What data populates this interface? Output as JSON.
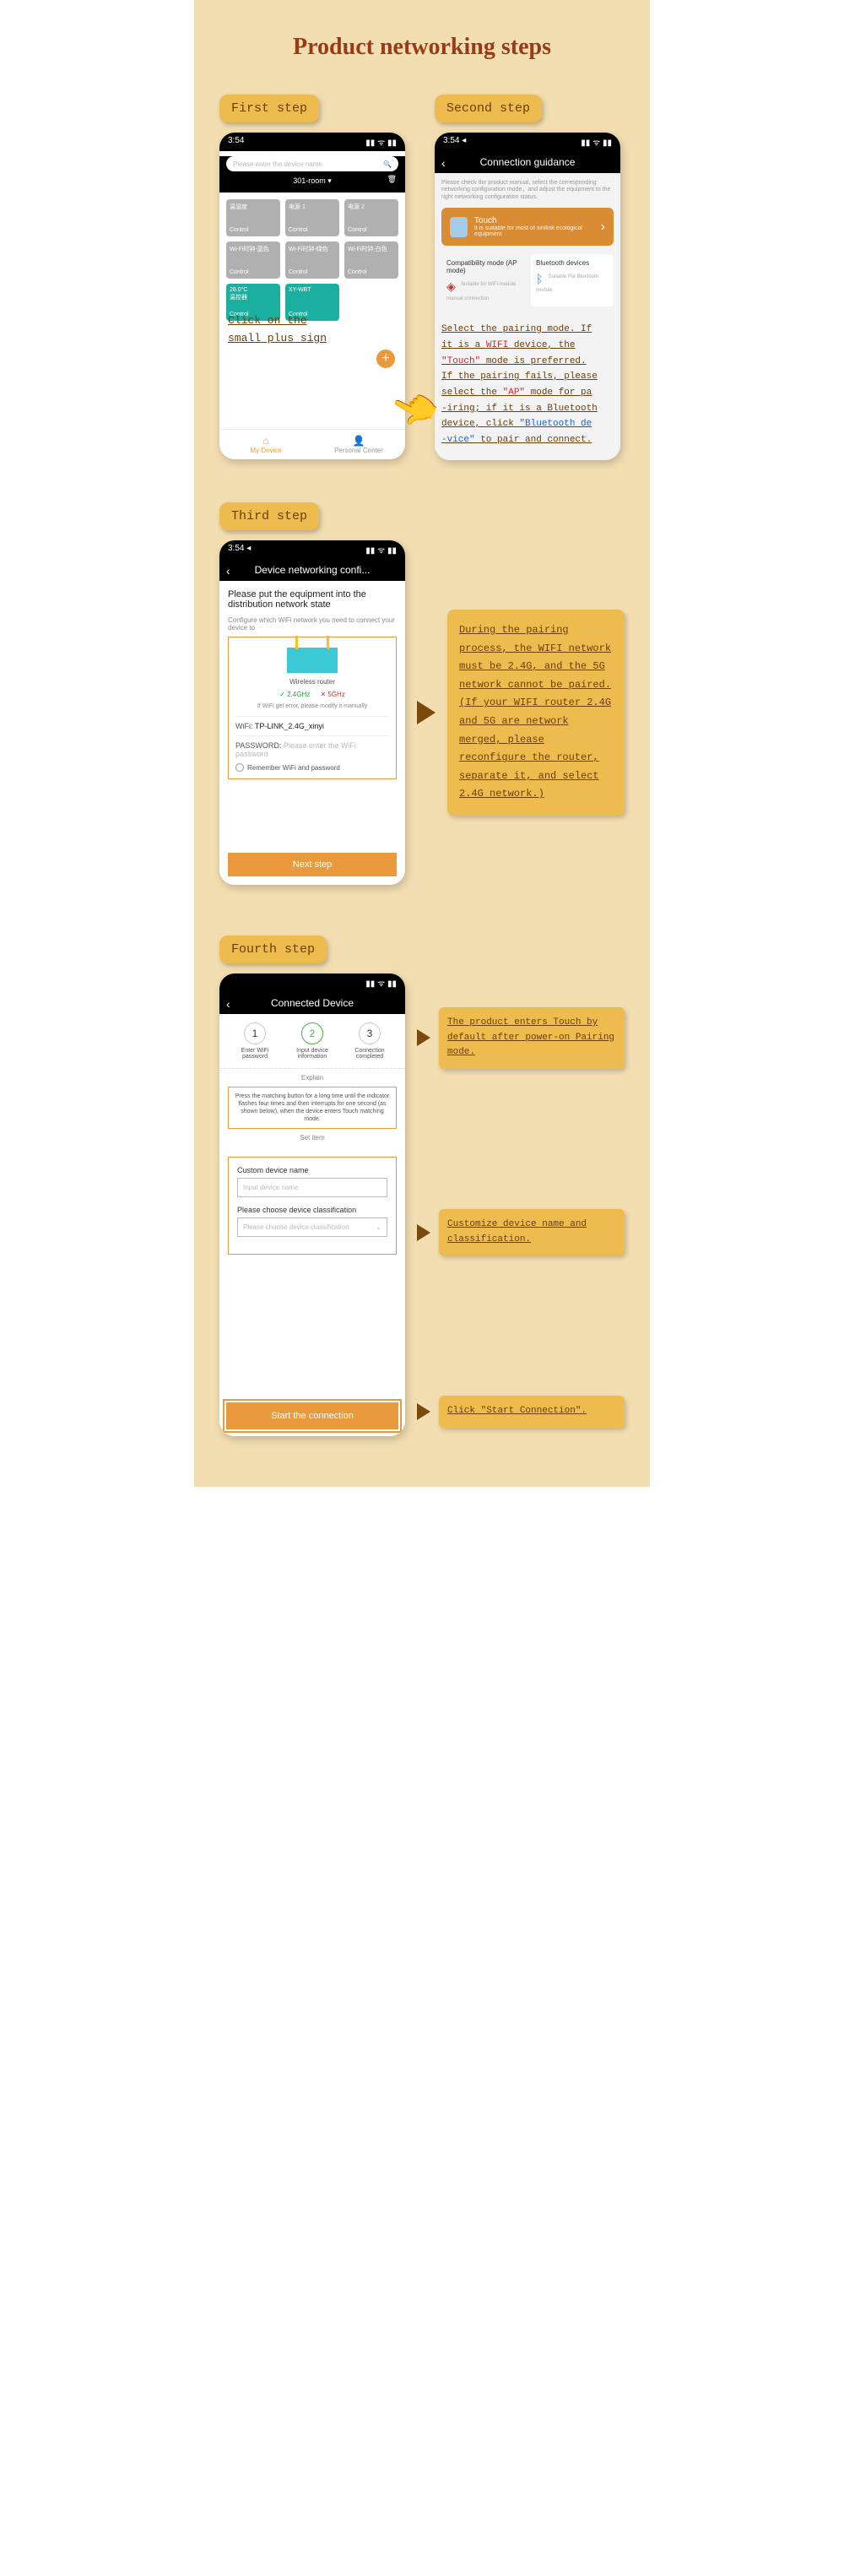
{
  "title": "Product networking steps",
  "steps": {
    "s1": "First step",
    "s2": "Second step",
    "s3": "Third step",
    "s4": "Fourth step"
  },
  "phone": {
    "time": "3:54",
    "time_arrow": "3:54 ◂",
    "signal": "▮▮ ᯤ ▮▮"
  },
  "step1": {
    "search_placeholder": "Please enter the device name",
    "room": "301-room ▾",
    "trash": "🗑",
    "tiles": [
      {
        "name": "温湿度",
        "control": "Control"
      },
      {
        "name": "电源 1",
        "control": "Control"
      },
      {
        "name": "电源 2",
        "control": "Control"
      },
      {
        "name": "Wi-Fi时钟-蓝色",
        "control": "Control"
      },
      {
        "name": "Wi-Fi时钟-绿色",
        "control": "Control"
      },
      {
        "name": "Wi-Fi时钟-白色",
        "control": "Control"
      }
    ],
    "green1_top": "28.0°C",
    "green1_name": "温控器",
    "green1_ctl": "Control",
    "green2_name": "XY-WBT",
    "green2_ctl": "Control",
    "nav_my": "My Device",
    "nav_center": "Personal Center",
    "annotation_l1": "Click on the",
    "annotation_l2": "small plus sign"
  },
  "step2": {
    "header": "Connection guidance",
    "intro": "Please check the product manual, select the corresponding networking configuration mode，and adjust the equipment to the right networking configuration status.",
    "touch_title": "Touch",
    "touch_sub": "It is suitable for most of sinilink ecological equipment",
    "ap_title": "Compatibility mode (AP mode)",
    "ap_sub": "Suitable for WiFi module manual connection",
    "bt_title": "Bluetooth devices",
    "bt_sub": "Suitable For Bluetooth module",
    "annot_1": "Select the pairing mode. If",
    "annot_2a": " it is a ",
    "annot_2b": "WIFI",
    "annot_2c": " device, the",
    "annot_3a": "\"Touch\"",
    "annot_3b": " mode is preferred.",
    "annot_4": "If the pairing fails, please",
    "annot_5a": "select the ",
    "annot_5b": "\"AP\"",
    "annot_5c": " mode for pa",
    "annot_6": "-iring; if it is a Bluetooth",
    "annot_7a": " device, click ",
    "annot_7b": "\"Bluetooth de",
    "annot_8a": "-vice\"",
    "annot_8b": " to pair and connect."
  },
  "step3": {
    "header": "Device networking confi...",
    "title": "Please put the equipment into the distribution network state",
    "sub": "Configure which WiFi network you need to connect your device to",
    "router_label": "Wireless router",
    "freq_ok": "✓ 2.4GHz",
    "freq_no": "✕ 5GHz",
    "wifi_note": "If WiFi get error, please modify it manually",
    "wifi_label": "WiFi:",
    "wifi_value": "TP-LINK_2.4G_xinyi",
    "pass_label": "PASSWORD:",
    "pass_placeholder": "Please enter the WiFi password",
    "remember": "Remember WiFi and password",
    "next": "Next step",
    "side": "During the pairing process, the WIFI network must be 2.4G, and the 5G network cannot be paired. (If your WIFI router 2.4G and 5G are network merged, please reconfigure the router, separate it, and select 2.4G network.)"
  },
  "step4": {
    "header": "Connected Device",
    "c1": "1",
    "c1_label": "Enter WiFi password",
    "c2": "2",
    "c2_label": "Input device information",
    "c3": "3",
    "c3_label": "Connection completed",
    "explain": "Explain",
    "press": "Press the matching button for a long time until the indicator flashes four times and then interrupts for one second (as shown below), when the device enters Touch matching mode.",
    "set_header": "Set item",
    "custom_label": "Custom device name",
    "custom_ph": "Input device name",
    "class_label": "Please choose device classification",
    "class_ph": "Please choose device classification",
    "start": "Start the connection",
    "side1": "The product enters Touch by default after power-on Pairing mode.",
    "side2": "Customize device name and classification.",
    "side3": "Click \"Start Connection\"."
  }
}
